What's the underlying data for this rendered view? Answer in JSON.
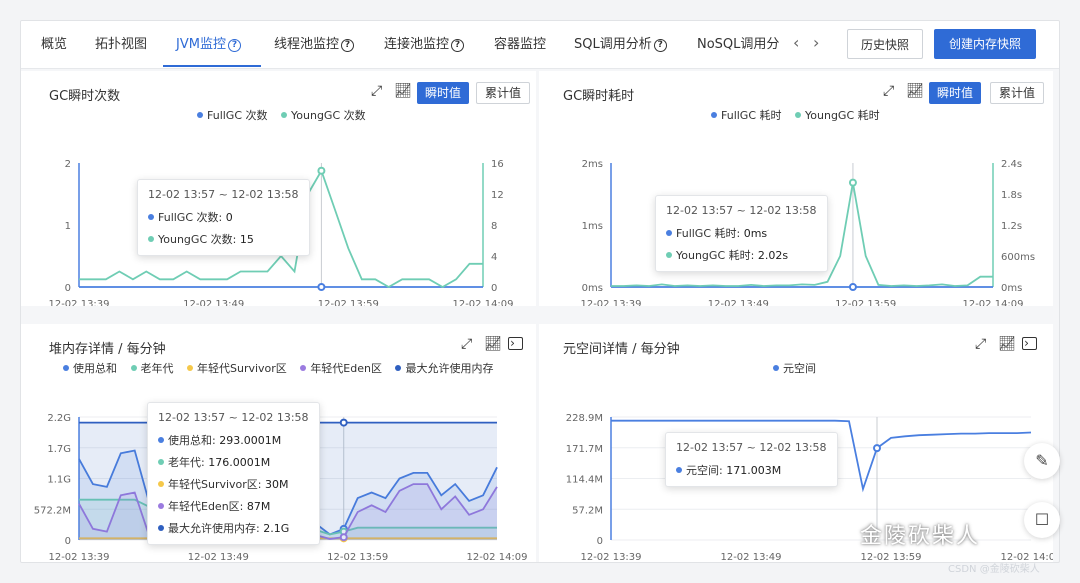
{
  "tabs": [
    {
      "label": "概览",
      "help": false
    },
    {
      "label": "拓扑视图",
      "help": false
    },
    {
      "label": "JVM监控",
      "help": true,
      "active": true
    },
    {
      "label": "线程池监控",
      "help": true
    },
    {
      "label": "连接池监控",
      "help": true
    },
    {
      "label": "容器监控",
      "help": false
    },
    {
      "label": "SQL调用分析",
      "help": true
    },
    {
      "label": "NoSQL调用分",
      "help": false
    }
  ],
  "nav": {
    "prev": "‹",
    "next": "›"
  },
  "buttons": {
    "history_snapshot": "历史快照",
    "create_snapshot": "创建内存快照"
  },
  "icons": {
    "expand": "expand-icon",
    "line_chart": "line-chart-icon",
    "console": "console-icon",
    "help": "question-circle-icon",
    "edit": "edit-icon",
    "comment": "comment-icon"
  },
  "colors": {
    "accent": "#2f6bd6",
    "fullgc": "#4a7fe0",
    "younggc": "#6fcdb4",
    "used": "#4a7fe0",
    "old": "#6fcdb4",
    "survivor": "#f5c84a",
    "eden": "#9b7be0",
    "max": "#2f5fc0"
  },
  "panels": {
    "gc_count": {
      "title": "GC瞬时次数",
      "toggle_instant": "瞬时值",
      "toggle_cumulative": "累计值",
      "legend": [
        "FullGC 次数",
        "YoungGC 次数"
      ],
      "tooltip": {
        "time": "12-02 13:57 ~ 12-02 13:58",
        "rows": [
          {
            "label": "FullGC 次数:",
            "value": "0"
          },
          {
            "label": "YoungGC 次数:",
            "value": "15"
          }
        ]
      }
    },
    "gc_time": {
      "title": "GC瞬时耗时",
      "toggle_instant": "瞬时值",
      "toggle_cumulative": "累计值",
      "legend": [
        "FullGC 耗时",
        "YoungGC 耗时"
      ],
      "tooltip": {
        "time": "12-02 13:57 ~ 12-02 13:58",
        "rows": [
          {
            "label": "FullGC 耗时:",
            "value": "0ms"
          },
          {
            "label": "YoungGC 耗时:",
            "value": "2.02s"
          }
        ]
      }
    },
    "heap": {
      "title": "堆内存详情 / 每分钟",
      "legend": [
        "使用总和",
        "老年代",
        "年轻代Survivor区",
        "年轻代Eden区",
        "最大允许使用内存"
      ],
      "tooltip": {
        "time": "12-02 13:57 ~ 12-02 13:58",
        "rows": [
          {
            "label": "使用总和:",
            "value": "293.0001M"
          },
          {
            "label": "老年代:",
            "value": "176.0001M"
          },
          {
            "label": "年轻代Survivor区:",
            "value": "30M"
          },
          {
            "label": "年轻代Eden区:",
            "value": "87M"
          },
          {
            "label": "最大允许使用内存:",
            "value": "2.1G"
          }
        ]
      }
    },
    "meta": {
      "title": "元空间详情 / 每分钟",
      "legend": [
        "元空间"
      ],
      "tooltip": {
        "time": "12-02 13:57 ~ 12-02 13:58",
        "rows": [
          {
            "label": "元空间:",
            "value": "171.003M"
          }
        ]
      }
    }
  },
  "chart_data": [
    {
      "type": "line",
      "title": "GC瞬时次数",
      "x_ticks": [
        "12-02 13:39",
        "12-02 13:49",
        "12-02 13:59",
        "12-02 14:09"
      ],
      "y_left_ticks": [
        "0",
        "1",
        "2"
      ],
      "y_right_ticks": [
        "0",
        "4",
        "8",
        "12",
        "16"
      ],
      "ylim_left": [
        0,
        2
      ],
      "ylim_right": [
        0,
        16
      ],
      "series": [
        {
          "name": "FullGC 次数",
          "axis": "left",
          "values": [
            0,
            0,
            0,
            0,
            0,
            0,
            0,
            0,
            0,
            0,
            0,
            0,
            0,
            0,
            0,
            0,
            0,
            0,
            0,
            0,
            0,
            0,
            0,
            0,
            0,
            0,
            0,
            0,
            0,
            0,
            0
          ]
        },
        {
          "name": "YoungGC 次数",
          "axis": "right",
          "values": [
            1,
            1,
            1,
            2,
            1,
            2,
            1,
            1,
            2,
            1,
            1,
            1,
            2,
            2,
            2,
            4,
            2,
            12,
            15,
            10,
            5,
            1,
            1,
            0,
            1,
            1,
            1,
            0,
            1,
            3,
            3
          ]
        }
      ]
    },
    {
      "type": "line",
      "title": "GC瞬时耗时",
      "x_ticks": [
        "12-02 13:39",
        "12-02 13:49",
        "12-02 13:59",
        "12-02 14:09"
      ],
      "y_left_ticks": [
        "0ms",
        "1ms",
        "2ms"
      ],
      "y_right_ticks": [
        "0ms",
        "600ms",
        "1.2s",
        "1.8s",
        "2.4s"
      ],
      "ylim_left": [
        0,
        2
      ],
      "ylim_right": [
        0,
        2.4
      ],
      "series": [
        {
          "name": "FullGC 耗时",
          "axis": "left",
          "values": [
            0,
            0,
            0,
            0,
            0,
            0,
            0,
            0,
            0,
            0,
            0,
            0,
            0,
            0,
            0,
            0,
            0,
            0,
            0,
            0,
            0,
            0,
            0,
            0,
            0,
            0,
            0,
            0,
            0,
            0,
            0
          ]
        },
        {
          "name": "YoungGC 耗时",
          "axis": "right",
          "values": [
            0.02,
            0.02,
            0.03,
            0.02,
            0.05,
            0.02,
            0.03,
            0.02,
            0.03,
            0.02,
            0.02,
            0.04,
            0.02,
            0.03,
            0.03,
            0.05,
            0.04,
            0.1,
            0.6,
            2.02,
            0.6,
            0.04,
            0.02,
            0.03,
            0.02,
            0.03,
            0.05,
            0.02,
            0.03,
            0.2,
            0.2
          ]
        }
      ]
    },
    {
      "type": "area",
      "title": "堆内存详情 / 每分钟",
      "x_ticks": [
        "12-02 13:39",
        "12-02 13:49",
        "12-02 13:59",
        "12-02 14:09"
      ],
      "y_ticks": [
        "0",
        "572.2M",
        "1.1G",
        "1.7G",
        "2.2G"
      ],
      "ylim": [
        0,
        2.2
      ],
      "series": [
        {
          "name": "使用总和",
          "values": [
            1.45,
            1.0,
            0.95,
            1.55,
            1.6,
            0.7,
            0.5,
            0.45,
            0.4,
            0.35,
            0.3,
            0.25,
            0.3,
            0.35,
            0.3,
            0.28,
            0.29,
            0.29,
            0.1,
            0.2,
            0.75,
            0.85,
            0.75,
            1.1,
            1.2,
            1.2,
            0.8,
            1.0,
            0.7,
            0.8,
            1.3
          ]
        },
        {
          "name": "老年代",
          "values": [
            0.72,
            0.72,
            0.72,
            0.72,
            0.72,
            0.6,
            0.5,
            0.4,
            0.35,
            0.3,
            0.25,
            0.2,
            0.2,
            0.2,
            0.2,
            0.18,
            0.18,
            0.18,
            0.1,
            0.15,
            0.22,
            0.22,
            0.22,
            0.22,
            0.22,
            0.22,
            0.22,
            0.22,
            0.22,
            0.22,
            0.22
          ]
        },
        {
          "name": "年轻代Survivor区",
          "values": [
            0.03,
            0.03,
            0.03,
            0.03,
            0.03,
            0.03,
            0.03,
            0.03,
            0.03,
            0.03,
            0.03,
            0.03,
            0.03,
            0.03,
            0.03,
            0.03,
            0.03,
            0.03,
            0.03,
            0.03,
            0.03,
            0.03,
            0.03,
            0.03,
            0.03,
            0.03,
            0.03,
            0.03,
            0.03,
            0.03,
            0.03
          ]
        },
        {
          "name": "年轻代Eden区",
          "values": [
            0.65,
            0.2,
            0.15,
            0.8,
            0.85,
            0.1,
            0.05,
            0.05,
            0.05,
            0.05,
            0.05,
            0.05,
            0.05,
            0.1,
            0.08,
            0.06,
            0.087,
            0.087,
            0.02,
            0.05,
            0.5,
            0.62,
            0.5,
            0.88,
            1.0,
            1.0,
            0.55,
            0.78,
            0.45,
            0.55,
            0.95
          ]
        },
        {
          "name": "最大允许使用内存",
          "values": [
            2.1,
            2.1,
            2.1,
            2.1,
            2.1,
            2.1,
            2.1,
            2.1,
            2.1,
            2.1,
            2.1,
            2.1,
            2.1,
            2.1,
            2.1,
            2.1,
            2.1,
            2.1,
            2.1,
            2.1,
            2.1,
            2.1,
            2.1,
            2.1,
            2.1,
            2.1,
            2.1,
            2.1,
            2.1,
            2.1,
            2.1
          ]
        }
      ]
    },
    {
      "type": "line",
      "title": "元空间详情 / 每分钟",
      "x_ticks": [
        "12-02 13:39",
        "12-02 13:49",
        "12-02 13:59",
        "12-02 14:09"
      ],
      "y_ticks": [
        "0",
        "57.2M",
        "114.4M",
        "171.7M",
        "228.9M"
      ],
      "ylim": [
        0,
        228.9
      ],
      "series": [
        {
          "name": "元空间",
          "values": [
            222,
            222,
            222,
            222,
            222,
            222,
            222,
            222,
            222,
            222,
            222,
            222,
            222,
            222,
            222,
            222,
            222,
            221,
            95,
            171,
            190,
            193,
            195,
            196,
            197,
            198,
            198,
            199,
            199,
            199,
            200
          ]
        }
      ]
    }
  ],
  "watermark": "金陵砍柴人",
  "watermark_small": "CSDN @金陵砍柴人"
}
